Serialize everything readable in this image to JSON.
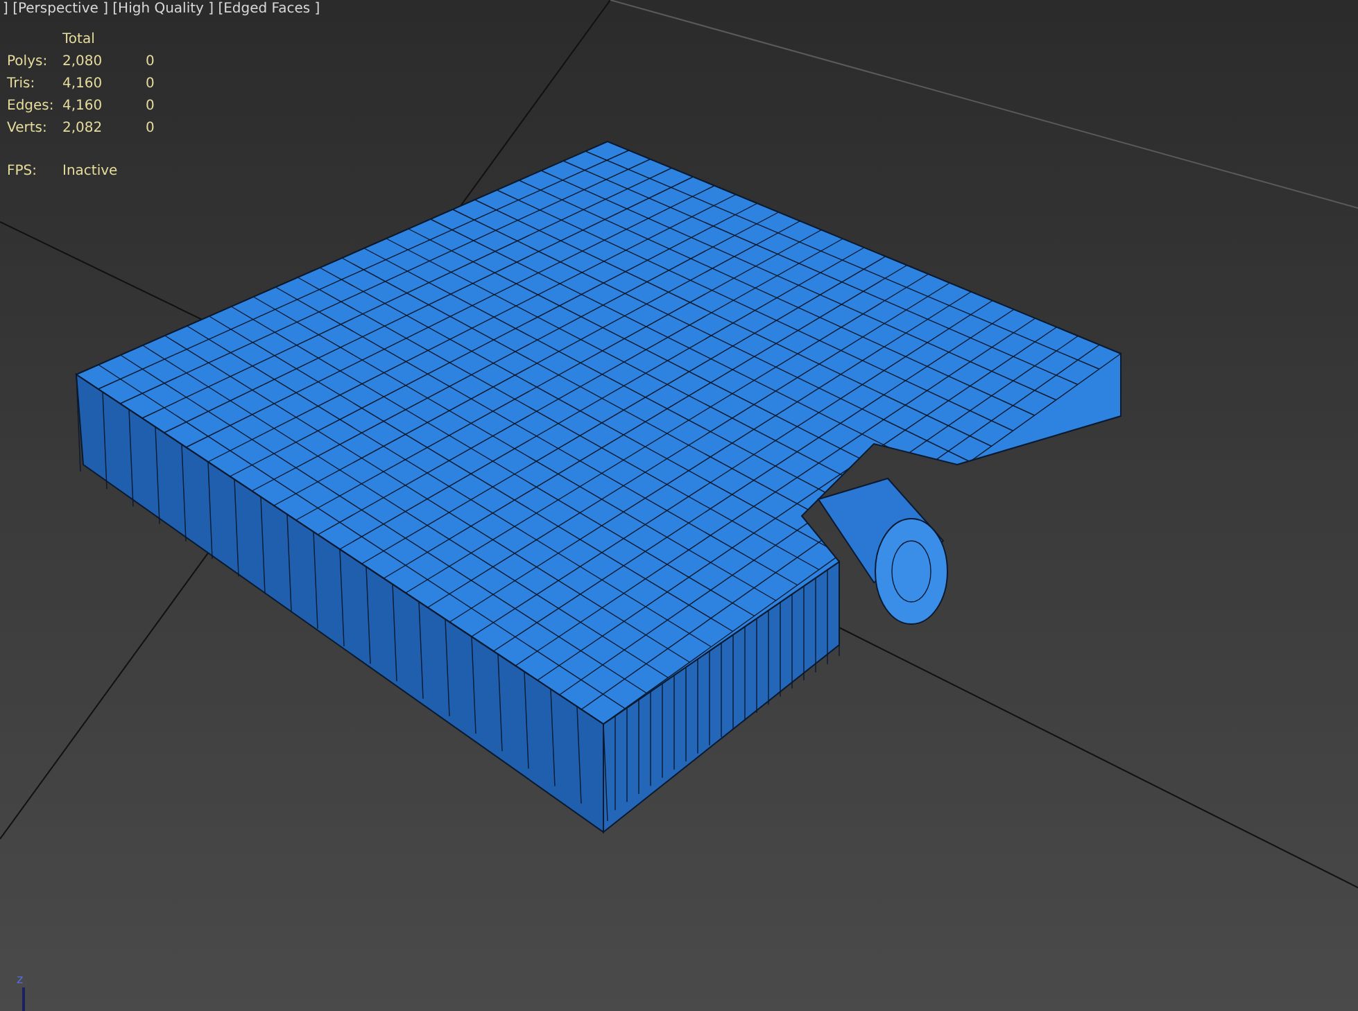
{
  "viewport": {
    "label": "] [Perspective ] [High Quality ] [Edged Faces ]",
    "stats": {
      "header": "Total",
      "rows": [
        {
          "name": "Polys:",
          "total": "2,080",
          "selected": "0"
        },
        {
          "name": "Tris:",
          "total": "4,160",
          "selected": "0"
        },
        {
          "name": "Edges:",
          "total": "4,160",
          "selected": "0"
        },
        {
          "name": "Verts:",
          "total": "2,082",
          "selected": "0"
        }
      ],
      "fps": {
        "name": "FPS:",
        "value": "Inactive"
      }
    },
    "axis_label": "z"
  }
}
